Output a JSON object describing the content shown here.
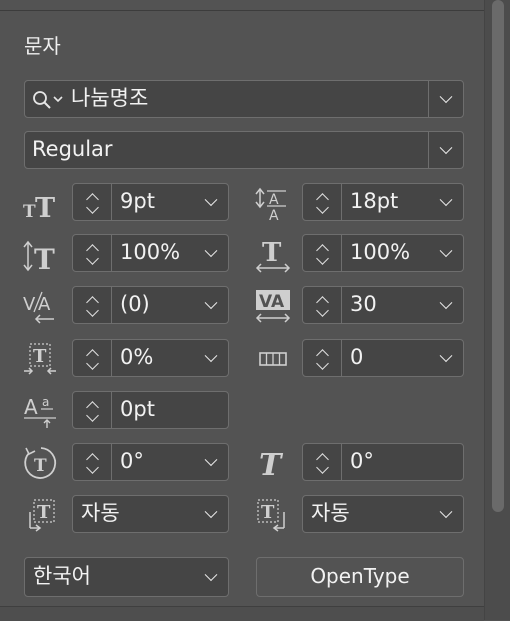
{
  "panel": {
    "title": "문자"
  },
  "font": {
    "family": "나눔명조",
    "style": "Regular"
  },
  "fields": {
    "size": "9pt",
    "leading": "18pt",
    "vertical_scale": "100%",
    "horizontal_scale": "100%",
    "kerning": "(0)",
    "tracking": "30",
    "tsume": "0%",
    "aki": "0",
    "baseline_shift": "0pt",
    "rotation": "0°",
    "skew": "0°",
    "mojikumi_before": "자동",
    "mojikumi_after": "자동"
  },
  "language": "한국어",
  "opentype_label": "OpenType"
}
